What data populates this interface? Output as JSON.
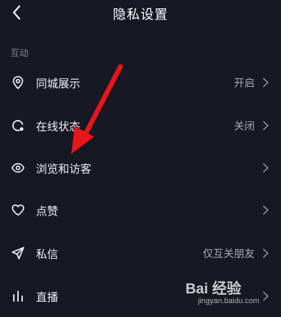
{
  "header": {
    "title": "隐私设置"
  },
  "section": {
    "label": "互动"
  },
  "rows": [
    {
      "icon": "location-pin-icon",
      "label": "同城展示",
      "value": "开启"
    },
    {
      "icon": "online-status-icon",
      "label": "在线状态",
      "value": "关闭"
    },
    {
      "icon": "eye-icon",
      "label": "浏览和访客",
      "value": ""
    },
    {
      "icon": "heart-icon",
      "label": "点赞",
      "value": ""
    },
    {
      "icon": "send-icon",
      "label": "私信",
      "value": "仅互关朋友"
    },
    {
      "icon": "bar-chart-icon",
      "label": "直播",
      "value": ""
    }
  ],
  "colors": {
    "background": "#161823",
    "annotation_arrow": "#e8151b"
  },
  "watermark": {
    "brand": "Bai 经验",
    "url": "jingyan.baidu.com"
  }
}
